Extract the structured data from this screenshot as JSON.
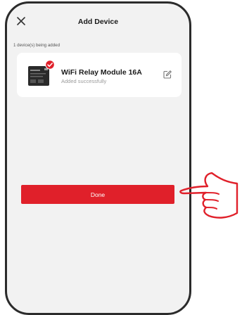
{
  "header": {
    "title": "Add Device",
    "close_icon": "close-icon"
  },
  "progress_text": "1 device(s) being added",
  "device": {
    "name": "WiFi Relay Module 16A",
    "status": "Added successfully",
    "thumbnail": "relay-module-thumbnail",
    "badge_icon": "check-badge-icon",
    "edit_icon": "edit-icon"
  },
  "done_button": {
    "label": "Done"
  },
  "annotation": {
    "icon": "hand-pointer-icon"
  },
  "colors": {
    "accent": "#e0202a",
    "background": "#f2f2f2",
    "card": "#ffffff",
    "frame": "#2b2b2b"
  }
}
